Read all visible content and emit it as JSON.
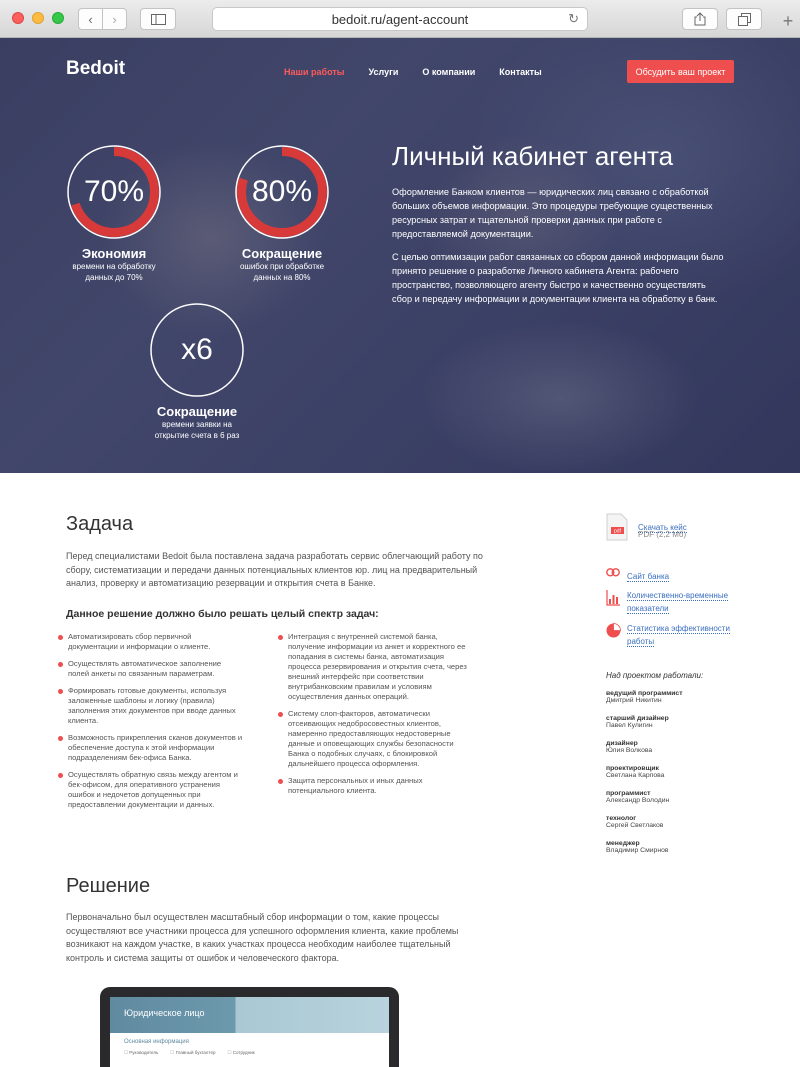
{
  "browser": {
    "url": "bedoit.ru/agent-account",
    "back_icon": "‹",
    "forward_icon": "›",
    "reload_icon": "↻",
    "new_tab_icon": "+"
  },
  "header": {
    "logo": "Bedoit",
    "nav": [
      "Наши работы",
      "Услуги",
      "О компании",
      "Контакты"
    ],
    "active_nav": "Наши работы",
    "cta": "Обсудить ваш проект",
    "accent_color": "#ef4e4e"
  },
  "stats": [
    {
      "value": "70%",
      "fraction": 0.7,
      "title": "Экономия",
      "sub1": "времени на обработку",
      "sub2": "данных до 70%"
    },
    {
      "value": "80%",
      "fraction": 0.8,
      "title": "Сокращение",
      "sub1": "ошибок при обработке",
      "sub2": "данных на 80%"
    },
    {
      "value": "x6",
      "fraction": 0,
      "title": "Сокращение",
      "sub1": "времени заявки на",
      "sub2": "открытие счета в 6 раз"
    }
  ],
  "hero": {
    "title": "Личный кабинет агента",
    "p1": "Оформление Банком клиентов — юридических лиц связано с обработкой больших объемов информации. Это процедуры требующие существенных ресурсных затрат и тщательной проверки данных при работе с предоставляемой документации.",
    "p2": "С целью оптимизации работ связанных со сбором данной информации было принято решение о разработке Личного кабинета Агента: рабочего пространство, позволяющего агенту быстро и качественно осуществлять сбор и передачу информации и документации клиента на обработку в банк."
  },
  "task": {
    "title": "Задача",
    "text": "Перед специалистами Bedoit была поставлена задача разработать сервис облегчающий работу по сбору, систематизации и передачи данных потенциальных клиентов юр. лиц на предварительный анализ, проверку и автоматизацию резервации и открытия счета в Банке.",
    "subtitle": "Данное решение должно было решать целый спектр задач:",
    "left_items": [
      "Автоматизировать сбор первичной документации и информации о клиенте.",
      "Осуществлять автоматическое заполнение полей анкеты по связанным параметрам.",
      "Формировать готовые документы, используя заложенные шаблоны и логику (правила) заполнения этих документов при вводе данных клиента.",
      "Возможность прикрепления сканов документов и обеспечение доступа к этой информации подразделениям бек-офиса Банка.",
      "Осуществлять обратную связь между агентом и бек-офисом, для оперативного устранения ошибок и недочетов допущенных при предоставлении документации и данных."
    ],
    "right_items": [
      "Интеграция с внутренней системой банка, получение информации из анкет и корректного ее попадания в системы банка, автоматизация процесса резервирования и открытия счета, через внешний интерфейс при соответствии внутрибанковским правилам и условиям осуществления данных операций.",
      "Систему слоп-факторов, автоматически отсеивающих недобросовестных клиентов, намеренно предоставляющих недостоверные данные и оповещающих службы безопасности Банка о подобных случаях, с блокировкой дальнейшего процесса оформления.",
      "Защита персональных и иных данных потенциального клиента."
    ]
  },
  "sidebar": {
    "download_label": "Скачать кейс",
    "download_meta": "PDF (2,2 Мб)",
    "pdf_badge": "pdf",
    "links": [
      "Сайт банка",
      "Количественно-временные показатели",
      "Статистика эффективности работы"
    ],
    "team_title": "Над проектом работали:",
    "team": [
      {
        "role": "ведущий программист",
        "name": "Дмитрий Никитин"
      },
      {
        "role": "старший дизайнер",
        "name": "Павел Кулигин"
      },
      {
        "role": "дизайнер",
        "name": "Юлия Волкова"
      },
      {
        "role": "проектировщик",
        "name": "Светлана Карпова"
      },
      {
        "role": "программист",
        "name": "Александр Володин"
      },
      {
        "role": "технолог",
        "name": "Сергей Светлаков"
      },
      {
        "role": "менеджер",
        "name": "Владимир Смирнов"
      }
    ]
  },
  "solution": {
    "title": "Решение",
    "text": "Первоначально был осуществлен масштабный сбор информации о том, какие процессы осуществляют все участники процесса для успешного оформления клиента, какие проблемы возникают на каждом участке, в каких участках процесса необходим наиболее тщательный контроль и система защиты от ошибок и человеческого фактора.",
    "mock_title": "Юридическое лицо",
    "mock_section": "Основная информация",
    "mock_options": [
      "Руководитель",
      "Главный бухгалтер",
      "Сотрудник"
    ]
  }
}
